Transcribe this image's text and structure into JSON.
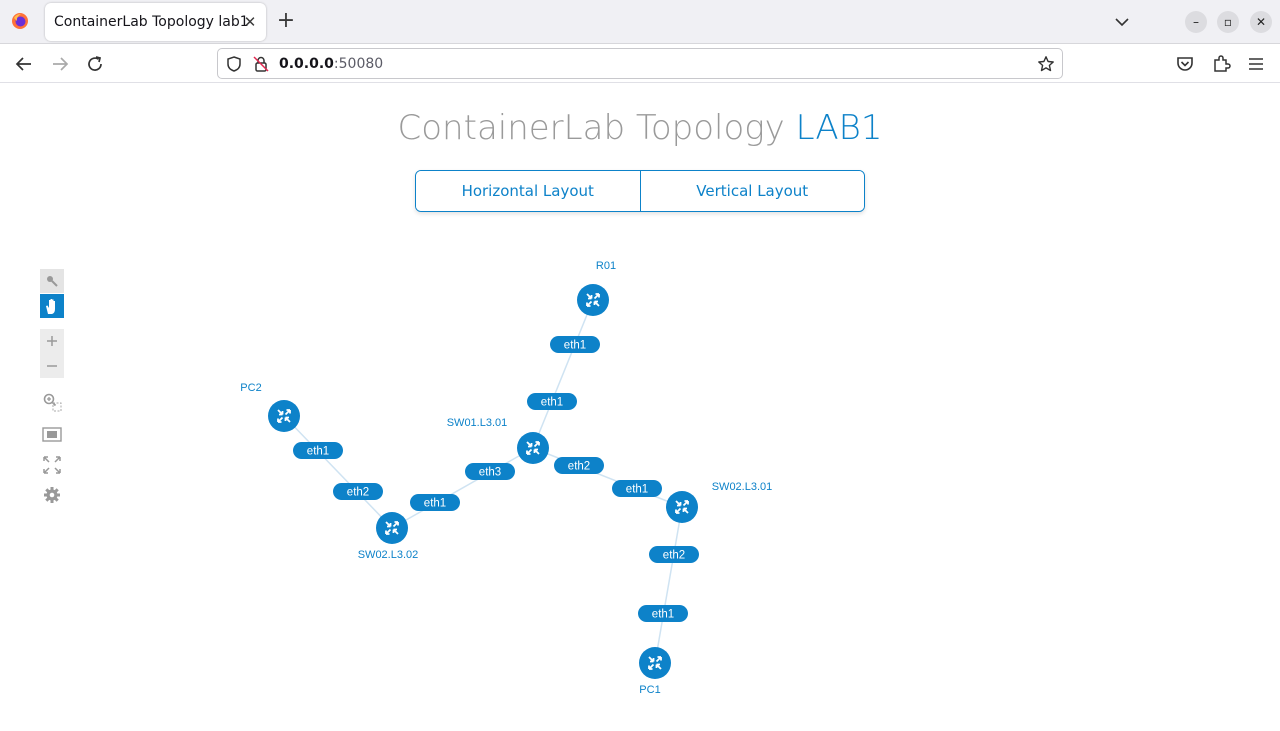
{
  "browser": {
    "tab_title": "ContainerLab Topology lab1",
    "url_host": "0.0.0.0",
    "url_port": ":50080",
    "icons": [
      "firefox-icon",
      "close-icon",
      "plus-icon",
      "chevron-down-icon",
      "minimize-icon",
      "restore-icon",
      "close-window-icon",
      "back-icon",
      "forward-icon",
      "reload-icon",
      "shield-icon",
      "lock-icon",
      "star-icon",
      "pocket-icon",
      "extensions-icon",
      "menu-icon"
    ]
  },
  "header": {
    "title_main": "ContainerLab Topology ",
    "title_accent": "LAB1",
    "accent_color": "#0d82c9"
  },
  "layout_buttons": {
    "horizontal": "Horizontal Layout",
    "vertical": "Vertical Layout"
  },
  "toolbar": {
    "icons": [
      "select-icon",
      "pan-hand-icon",
      "zoom-in-icon",
      "zoom-out-icon",
      "zoom-selection-icon",
      "fit-view-icon",
      "fullscreen-icon",
      "settings-gear-icon"
    ]
  },
  "topology": {
    "nodes": {
      "r01": "R01",
      "pc2": "PC2",
      "sw01": "SW01.L3.01",
      "sw02_l3_01": "SW02.L3.01",
      "sw02_l3_02": "SW02.L3.02",
      "pc1": "PC1"
    },
    "links": [
      {
        "from": "R01",
        "to": "SW01.L3.01",
        "from_port": "eth1",
        "to_port": "eth1"
      },
      {
        "from": "PC2",
        "to": "SW02.L3.02",
        "from_port": "eth1",
        "to_port": "eth2"
      },
      {
        "from": "SW01.L3.01",
        "to": "SW02.L3.02",
        "from_port": "eth3",
        "to_port": "eth1"
      },
      {
        "from": "SW01.L3.01",
        "to": "SW02.L3.01",
        "from_port": "eth2",
        "to_port": "eth1"
      },
      {
        "from": "SW02.L3.01",
        "to": "PC1",
        "from_port": "eth2",
        "to_port": "eth1"
      }
    ],
    "node_color": "#0d82c9",
    "link_color": "#cfe3f2"
  }
}
